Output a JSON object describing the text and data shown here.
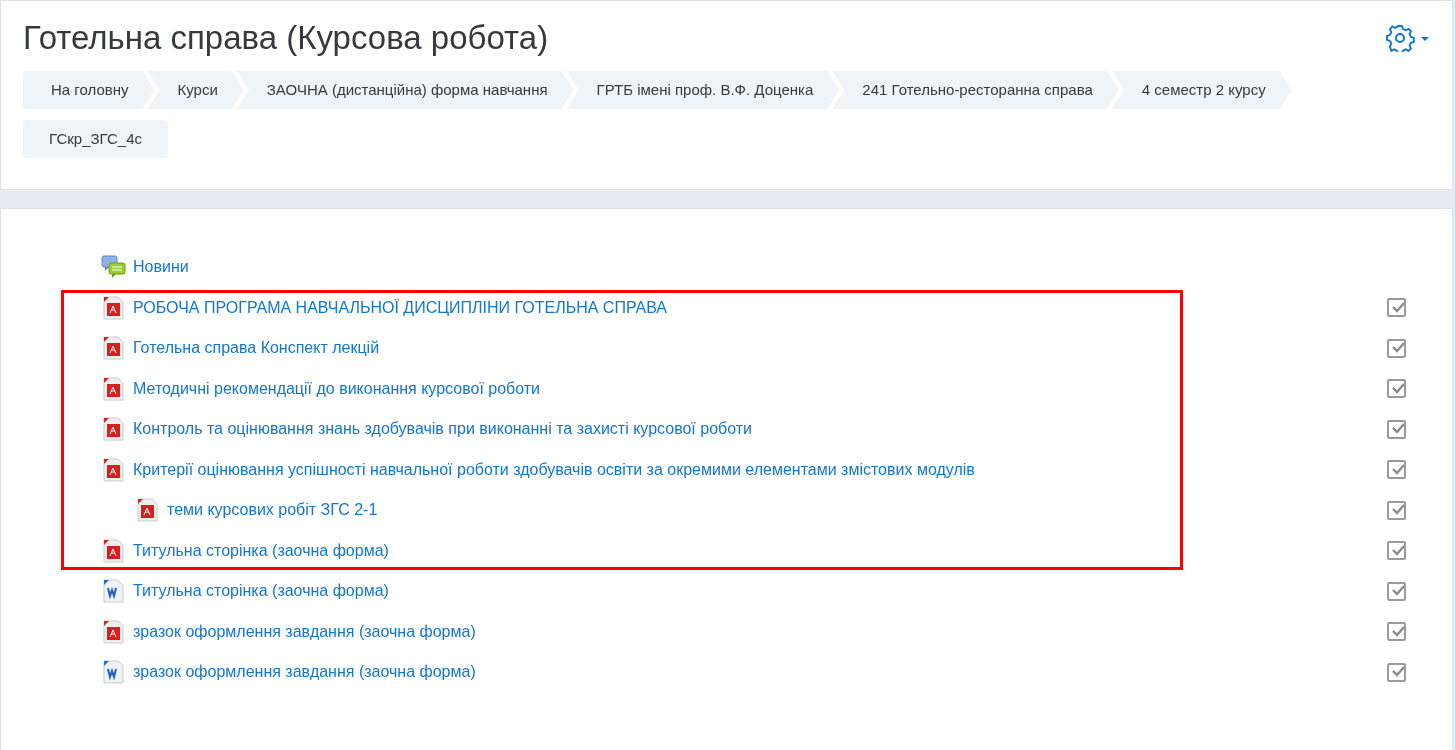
{
  "page_title": "Готельна справа (Курсова робота)",
  "breadcrumbs": [
    {
      "label": "На головну"
    },
    {
      "label": "Курси"
    },
    {
      "label": "ЗАОЧНА (дистанційна) форма навчання"
    },
    {
      "label": "ГРТБ імені проф. В.Ф. Доценка"
    },
    {
      "label": "241 Готельно-ресторанна справа"
    },
    {
      "label": "4 семестр 2 курсу"
    },
    {
      "label": "ГСкр_ЗГС_4с"
    }
  ],
  "activities": [
    {
      "kind": "forum",
      "label": "Новини",
      "highlighted": false
    },
    {
      "kind": "pdf",
      "label": "РОБОЧА ПРОГРАМА НАВЧАЛЬНОЇ ДИСЦИПЛІНИ ГОТЕЛЬНА СПРАВА",
      "completed": true,
      "highlighted": true
    },
    {
      "kind": "pdf",
      "label": "Готельна справа Конспект лекцій",
      "completed": true,
      "highlighted": true
    },
    {
      "kind": "pdf",
      "label": "Методичні рекомендації до виконання курсової роботи",
      "completed": true,
      "highlighted": true
    },
    {
      "kind": "pdf",
      "label": "Контроль та оцінювання знань здобувачів при виконанні та захисті курсової роботи",
      "completed": true,
      "highlighted": true
    },
    {
      "kind": "pdf",
      "label": "Критерії оцінювання успішності навчальної роботи здобувачів освіти за окремими елементами змістових модулів",
      "completed": true,
      "highlighted": true,
      "children": [
        {
          "kind": "pdf",
          "label": "теми курсових робіт ЗГС 2-1",
          "completed": true
        }
      ]
    },
    {
      "kind": "pdf",
      "label": "Титульна сторінка (заочна форма)",
      "completed": true,
      "highlighted": true
    },
    {
      "kind": "word",
      "label": "Титульна сторінка (заочна форма)",
      "completed": true,
      "highlighted": false
    },
    {
      "kind": "pdf",
      "label": "зразок оформлення завдання (заочна форма)",
      "completed": true,
      "highlighted": false
    },
    {
      "kind": "word",
      "label": "зразок оформлення завдання (заочна форма)",
      "completed": true,
      "highlighted": false
    }
  ]
}
